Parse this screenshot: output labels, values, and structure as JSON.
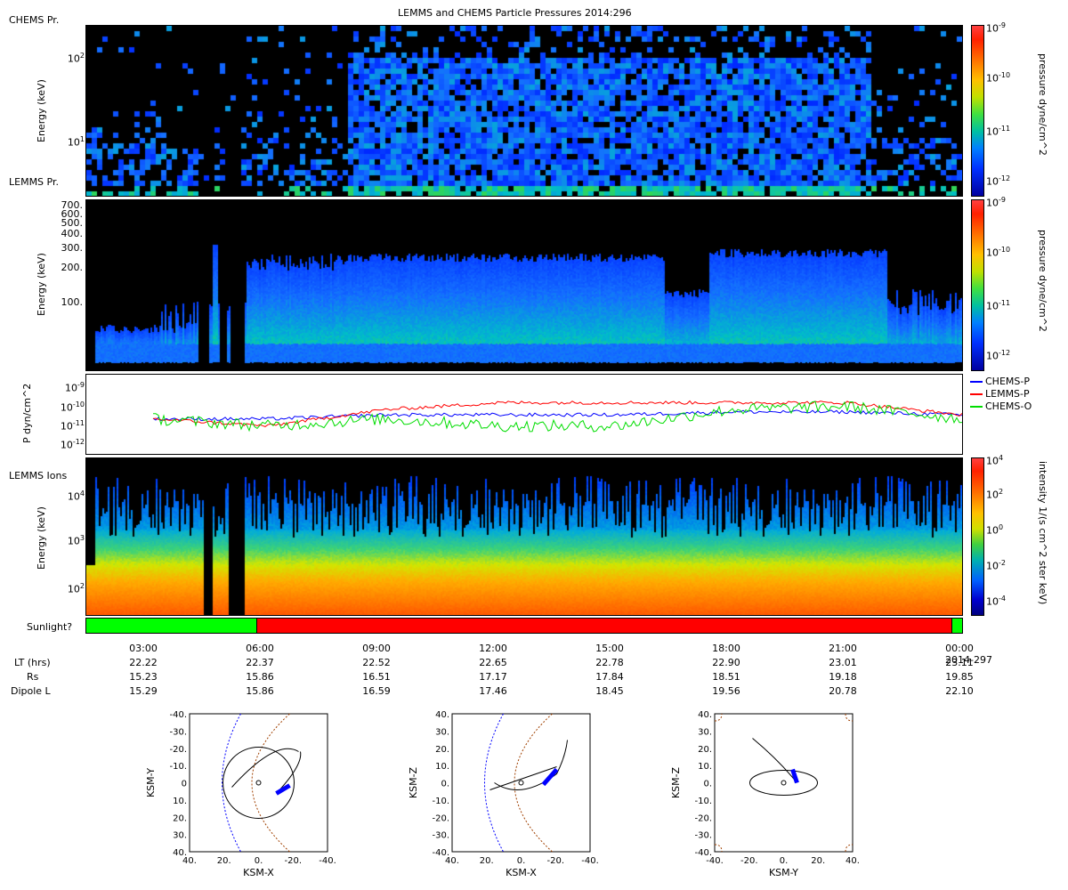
{
  "title": "LEMMS and CHEMS Particle Pressures  2014:296",
  "panels": {
    "chems": {
      "label": "CHEMS Pr.",
      "ylabel": "Energy (keV)",
      "yticks": [
        {
          "text": "10",
          "sup": "2"
        },
        {
          "text": "10",
          "sup": "1"
        }
      ],
      "cbar_title": "pressure dyne/cm^2",
      "cbar_ticks": [
        {
          "text": "10",
          "sup": "-9"
        },
        {
          "text": "10",
          "sup": "-10"
        },
        {
          "text": "10",
          "sup": "-11"
        },
        {
          "text": "10",
          "sup": "-12"
        }
      ]
    },
    "lemms_pr": {
      "label": "LEMMS Pr.",
      "ylabel": "Energy (keV)",
      "yticks": [
        "700.",
        "600.",
        "500.",
        "400.",
        "300.",
        "200.",
        "100."
      ],
      "cbar_title": "pressure dyne/cm^2",
      "cbar_ticks": [
        {
          "text": "10",
          "sup": "-9"
        },
        {
          "text": "10",
          "sup": "-10"
        },
        {
          "text": "10",
          "sup": "-11"
        },
        {
          "text": "10",
          "sup": "-12"
        }
      ]
    },
    "pressure": {
      "ylabel": "P dyn/cm^2",
      "yticks": [
        {
          "text": "10",
          "sup": "-9"
        },
        {
          "text": "10",
          "sup": "-10"
        },
        {
          "text": "10",
          "sup": "-11"
        },
        {
          "text": "10",
          "sup": "-12"
        }
      ],
      "legend": [
        {
          "name": "CHEMS-P",
          "color": "#0000ff"
        },
        {
          "name": "LEMMS-P",
          "color": "#ff0000"
        },
        {
          "name": "CHEMS-O",
          "color": "#00dd00"
        }
      ]
    },
    "lemms_ions": {
      "label": "LEMMS Ions",
      "ylabel": "Energy (keV)",
      "yticks": [
        {
          "text": "10",
          "sup": "4"
        },
        {
          "text": "10",
          "sup": "3"
        },
        {
          "text": "10",
          "sup": "2"
        }
      ],
      "cbar_title": "intensity 1/(s cm^2 ster keV)",
      "cbar_ticks": [
        {
          "text": "10",
          "sup": "4"
        },
        {
          "text": "10",
          "sup": "2"
        },
        {
          "text": "10",
          "sup": "0"
        },
        {
          "text": "10",
          "sup": "-2"
        },
        {
          "text": "10",
          "sup": "-4"
        }
      ]
    },
    "sunlight": {
      "label": "Sunlight?",
      "segments": [
        {
          "from": 0.0,
          "to": 0.194,
          "color": "#00ff00"
        },
        {
          "from": 0.194,
          "to": 0.988,
          "color": "#ff0000"
        },
        {
          "from": 0.988,
          "to": 1.0,
          "color": "#00ff00"
        }
      ]
    }
  },
  "time_axis": {
    "ticks": [
      "03:00",
      "06:00",
      "09:00",
      "12:00",
      "15:00",
      "18:00",
      "21:00",
      "00:00"
    ],
    "end_date": "2014-297"
  },
  "ephemeris": {
    "rows": [
      {
        "label": "LT (hrs)",
        "values": [
          "22.22",
          "22.37",
          "22.52",
          "22.65",
          "22.78",
          "22.90",
          "23.01",
          "23.11"
        ]
      },
      {
        "label": "Rs",
        "values": [
          "15.23",
          "15.86",
          "16.51",
          "17.17",
          "17.84",
          "18.51",
          "19.18",
          "19.85"
        ]
      },
      {
        "label": "Dipole L",
        "values": [
          "15.29",
          "15.86",
          "16.59",
          "17.46",
          "18.45",
          "19.56",
          "20.78",
          "22.10"
        ]
      }
    ]
  },
  "chart_data": [
    {
      "type": "heatmap",
      "title": "LEMMS and CHEMS Particle Pressures  2014:296",
      "panel": "CHEMS Pr.",
      "ylabel": "Energy (keV)",
      "yscale": "log",
      "colorbar": "pressure dyne/cm^2",
      "color_range": [
        "1e-12",
        "1e-9"
      ],
      "x": [
        "03:00",
        "06:00",
        "09:00",
        "12:00",
        "15:00",
        "18:00",
        "21:00",
        "00:00"
      ]
    },
    {
      "type": "heatmap",
      "panel": "LEMMS Pr.",
      "ylabel": "Energy (keV)",
      "yscale": "log",
      "colorbar": "pressure dyne/cm^2",
      "color_range": [
        "1e-12",
        "1e-9"
      ]
    },
    {
      "type": "line",
      "ylabel": "P dyn/cm^2",
      "yscale": "log",
      "ylim": [
        "1e-12",
        "1e-9"
      ],
      "x": [
        "03:00",
        "06:00",
        "09:00",
        "12:00",
        "15:00",
        "18:00",
        "21:00",
        "00:00"
      ],
      "series": [
        {
          "name": "CHEMS-P",
          "values": [
            "2e-11",
            "2e-11",
            "3e-11",
            "3e-11",
            "3e-11",
            "4e-11",
            "4e-11",
            "3e-11"
          ]
        },
        {
          "name": "LEMMS-P",
          "values": [
            "2e-11",
            "1e-11",
            "5e-11",
            "1e-10",
            "1e-10",
            "1e-10",
            "1e-10",
            "3e-11"
          ]
        },
        {
          "name": "CHEMS-O",
          "values": [
            "2e-11",
            "1e-11",
            "2e-11",
            "1e-11",
            "1e-11",
            "5e-11",
            "7e-11",
            "2e-11"
          ]
        }
      ]
    },
    {
      "type": "heatmap",
      "panel": "LEMMS Ions",
      "ylabel": "Energy (keV)",
      "yscale": "log",
      "colorbar": "intensity 1/(s cm^2 ster keV)",
      "color_range": [
        "1e-4",
        "1e4"
      ]
    }
  ],
  "orbits": [
    {
      "xlabel": "KSM-X",
      "ylabel": "KSM-Y",
      "xticks": [
        "40.",
        "20.",
        "0.",
        "-20.",
        "-40."
      ],
      "yticks": [
        "-40.",
        "-30.",
        "-20.",
        "-10.",
        "0",
        "10.",
        "20.",
        "30.",
        "40."
      ]
    },
    {
      "xlabel": "KSM-X",
      "ylabel": "KSM-Z",
      "xticks": [
        "40.",
        "20.",
        "0.",
        "-20.",
        "-40."
      ],
      "yticks": [
        "40.",
        "30.",
        "20.",
        "10.",
        "0.",
        "-10.",
        "-20.",
        "-30.",
        "-40."
      ]
    },
    {
      "xlabel": "KSM-Y",
      "ylabel": "KSM-Z",
      "xticks": [
        "-40.",
        "-20.",
        "0.",
        "20.",
        "40."
      ],
      "yticks": [
        "40.",
        "30.",
        "20.",
        "10.",
        "0.",
        "-10.",
        "-20.",
        "-30.",
        "-40."
      ]
    }
  ]
}
